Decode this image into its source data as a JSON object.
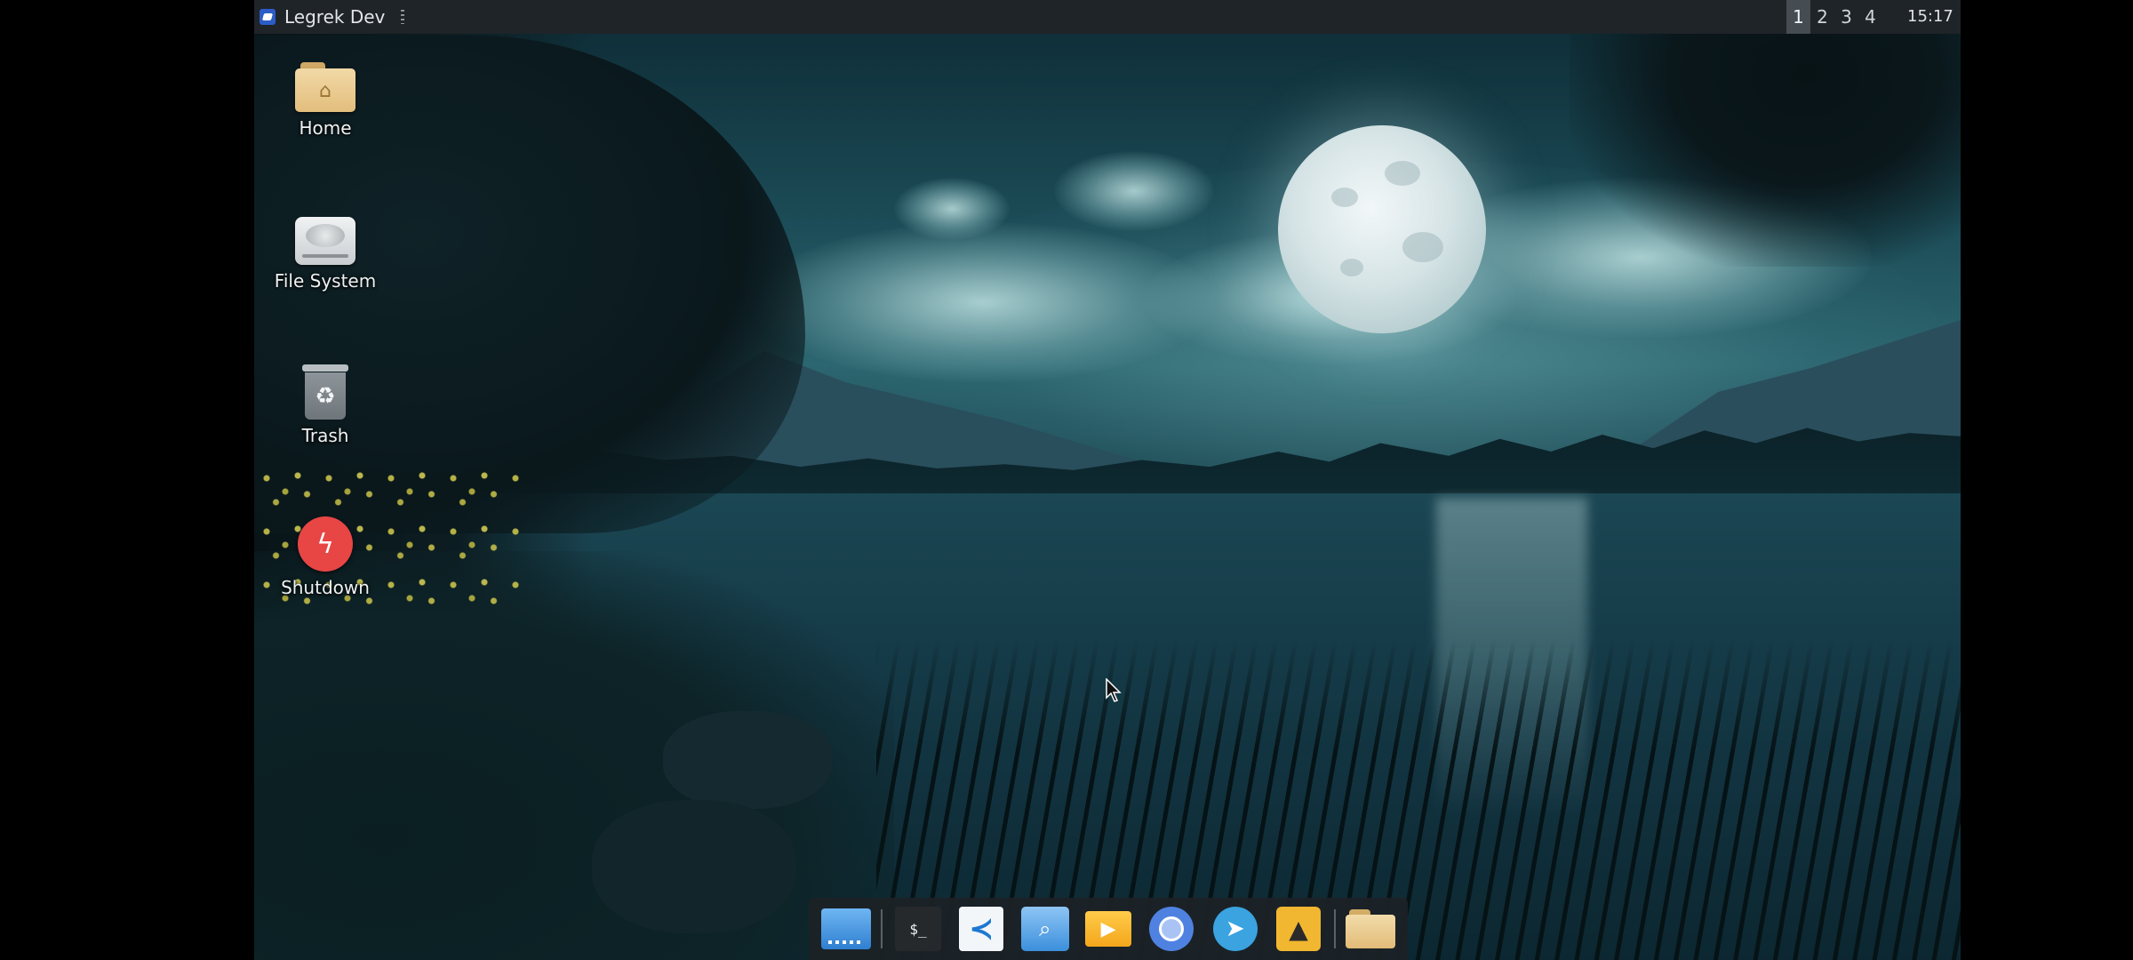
{
  "panel": {
    "window_title": "Legrek Dev",
    "workspaces": [
      "1",
      "2",
      "3",
      "4"
    ],
    "active_workspace": "1",
    "clock": "15:17"
  },
  "desktop": {
    "icons": [
      {
        "label": "Home",
        "icon": "home-folder-icon"
      },
      {
        "label": "File System",
        "icon": "drive-icon"
      },
      {
        "label": "Trash",
        "icon": "trash-icon"
      },
      {
        "label": "Shutdown",
        "icon": "shutdown-icon"
      }
    ]
  },
  "dock": {
    "items": [
      {
        "icon": "show-desktop-icon"
      },
      {
        "icon": "terminal-icon",
        "glyph": "$_"
      },
      {
        "icon": "vscode-icon"
      },
      {
        "icon": "file-search-icon"
      },
      {
        "icon": "media-player-icon"
      },
      {
        "icon": "chromium-icon"
      },
      {
        "icon": "telegram-icon"
      },
      {
        "icon": "inkscape-icon"
      },
      {
        "icon": "file-manager-icon"
      }
    ]
  },
  "colors": {
    "panel_bg": "#1f2428",
    "dock_bg": "#1c2226",
    "shutdown_red": "#e84545",
    "workspace_active": "#454c52"
  }
}
